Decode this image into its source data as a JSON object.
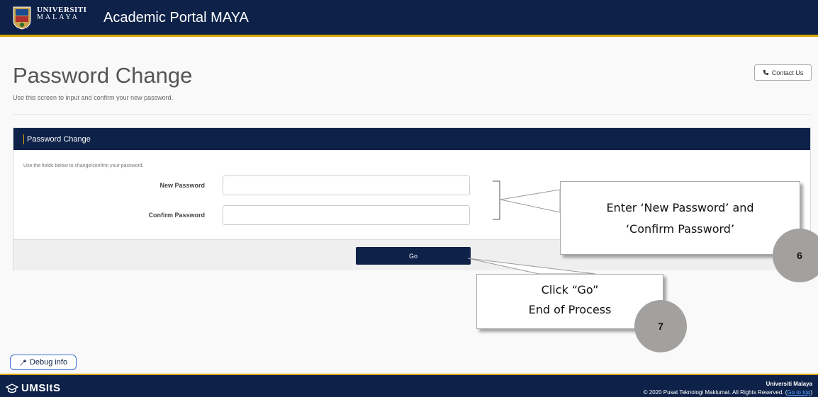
{
  "header": {
    "logo_line1": "UNIVERSITI",
    "logo_line2": "MALAYA",
    "app_title": "Academic Portal MAYA"
  },
  "page": {
    "title": "Password Change",
    "subtitle": "Use this screen to input and confirm your new password.",
    "contact_label": "Contact Us"
  },
  "panel": {
    "heading": "Password Change",
    "note": "Use the fields below to change/confirm your password.",
    "new_password_label": "New Password",
    "confirm_password_label": "Confirm Password",
    "go_label": "Go"
  },
  "annotations": {
    "callout1_line1": "Enter ‘New Password’ and",
    "callout1_line2": "‘Confirm Password’",
    "step6": "6",
    "callout2_line1": "Click “Go”",
    "callout2_line2": "End of Process",
    "step7": "7"
  },
  "debug": {
    "label": "Debug info"
  },
  "footer": {
    "brand": "UMSItS",
    "university": "Universiti Malaya",
    "copyright": "© 2020 Pusat Teknologi Maklumat. All Rights Reserved. (",
    "go_top": "Go to top",
    "copyright_end": ")"
  },
  "colors": {
    "navy": "#0d2149",
    "gold": "#d9a400",
    "badge_gray": "#a3a19f"
  }
}
